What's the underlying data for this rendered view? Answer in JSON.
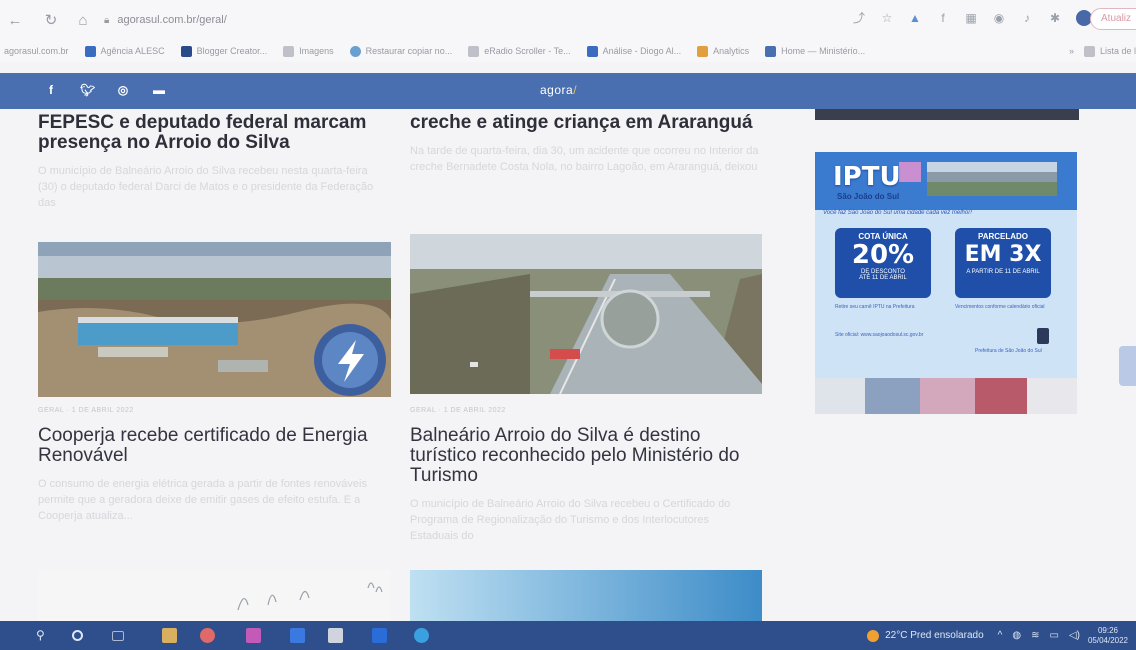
{
  "browser": {
    "url": "agorasul.com.br/geral/",
    "update_label": "Atualiz"
  },
  "bookmarks": [
    {
      "label": "agorasul.com.br",
      "color": "#f7f7f9"
    },
    {
      "label": "Agência ALESC",
      "color": "#3a6cc0"
    },
    {
      "label": "Blogger Creator...",
      "color": "#2a4b8a"
    },
    {
      "label": "Imagens",
      "color": "#c0c0c8"
    },
    {
      "label": "Restaurar copiar no...",
      "color": "#6aa0d0"
    },
    {
      "label": "eRadio Scroller - Te...",
      "color": "#c0c0c8"
    },
    {
      "label": "Análise - Diogo Al...",
      "color": "#3a6cc0"
    },
    {
      "label": "Analytics",
      "color": "#e0a040"
    },
    {
      "label": "Home — Ministério...",
      "color": "#4a6fb0"
    }
  ],
  "bookmarks_right": {
    "more": "»",
    "reading_list": "Lista de l"
  },
  "site": {
    "logo_main": "agora",
    "logo_mark": "/",
    "social": [
      "f",
      "t",
      "ig",
      "yt"
    ]
  },
  "articles": [
    {
      "title": "FEPESC e deputado federal marcam presença no Arroio do Silva",
      "excerpt": "O município de Balneário Arroio do Silva recebeu nesta quarta-feira (30) o deputado federal Darci de Matos e o presidente da Federação das"
    },
    {
      "title": "creche e atinge criança em Araranguá",
      "excerpt": "Na tarde de quarta-feira, dia 30, um acidente que ocorreu no Interior da creche Bernadete Costa Nola, no bairro Lagoão, em Araranguá, deixou"
    },
    {
      "meta": "GERAL · 1 DE ABRIL 2022",
      "title": "Cooperja recebe certificado de Energia Renovável",
      "excerpt": "O consumo de energia elétrica gerada a partir de fontes renováveis permite que a geradora deixe de emitir gases de efeito estufa. E a Cooperja atualiza..."
    },
    {
      "meta": "GERAL · 1 DE ABRIL 2022",
      "title": "Balneário Arroio do Silva é destino turístico reconhecido pelo Ministério do Turismo",
      "excerpt": "O município de Balneário Arroio do Silva recebeu o Certificado do Programa de Regionalização do Turismo e dos Interlocutores Estaduais do"
    }
  ],
  "ad": {
    "title": "IPTU",
    "city": "São João do Sul",
    "tagline": "Você faz São João do Sul uma cidade cada vez melhor!",
    "box1": {
      "heading": "COTA ÚNICA",
      "value": "20%",
      "sub": "DE DESCONTO",
      "note": "ATÉ 11 DE ABRIL"
    },
    "box2": {
      "heading": "PARCELADO",
      "value": "EM 3X",
      "note": "A PARTIR DE 11 DE ABRIL"
    },
    "line1": "Retire seu carnê IPTU na Prefeitura",
    "line2": "Vencimentos conforme calendário oficial",
    "line3": "Site oficial: www.saojoaodosul.sc.gov.br",
    "footer": "Prefeitura de São João do Sul"
  },
  "taskbar": {
    "weather": "22°C  Pred ensolarado",
    "time": "09:26",
    "date": "05/04/2022"
  },
  "colors": {
    "header_blue": "#4a6fb0",
    "taskbar_blue": "#2f4f8c",
    "ad_blue": "#1f4fa8"
  }
}
